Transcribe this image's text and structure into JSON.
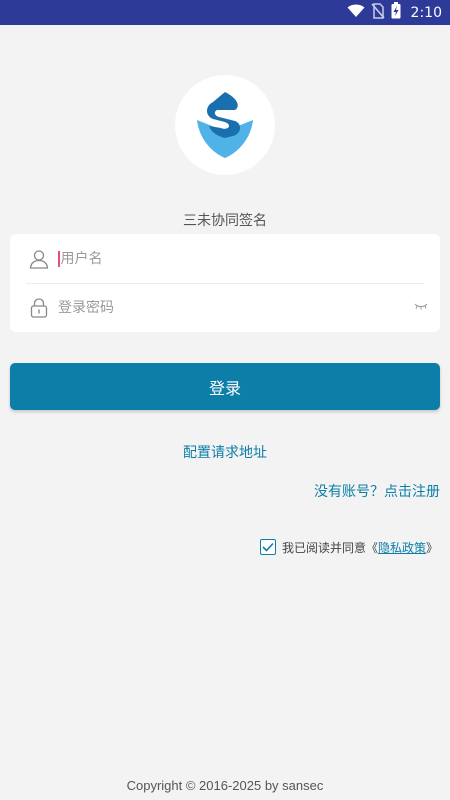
{
  "status_bar": {
    "time": "2:10",
    "icons": [
      "wifi-icon",
      "no-sim-icon",
      "battery-charging-icon"
    ]
  },
  "app": {
    "title": "三未协同签名",
    "logo": "sansec-shield-logo"
  },
  "login_form": {
    "username_placeholder": "用户名",
    "password_placeholder": "登录密码",
    "login_button": "登录"
  },
  "links": {
    "config_server": "配置请求地址",
    "register": "没有账号？点击注册"
  },
  "agreement": {
    "checked": true,
    "prefix": "我已阅读并同意《",
    "policy": "隐私政策",
    "suffix": "》"
  },
  "footer": {
    "copyright": "Copyright © 2016-2025 by sansec"
  },
  "colors": {
    "status_bar": "#2e3a97",
    "accent": "#0d7ea8",
    "background": "#f3f3f3",
    "logo_light_blue": "#4fb3e8",
    "logo_dark_blue": "#1a6fae"
  }
}
